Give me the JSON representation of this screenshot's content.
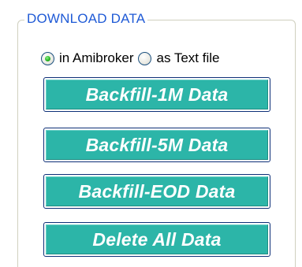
{
  "group": {
    "title": "DOWNLOAD DATA"
  },
  "download_target": {
    "options": [
      {
        "label": "in Amibroker",
        "selected": true
      },
      {
        "label": "as Text file",
        "selected": false
      }
    ]
  },
  "buttons": {
    "backfill_1m": "Backfill-1M Data",
    "backfill_5m": "Backfill-5M Data",
    "backfill_eod": "Backfill-EOD Data",
    "delete_all": "Delete All Data"
  },
  "colors": {
    "button_fill": "#2cb5a8",
    "button_border": "#0d2f77",
    "legend_text": "#1f5ad6",
    "radio_dot": "#29b524"
  }
}
